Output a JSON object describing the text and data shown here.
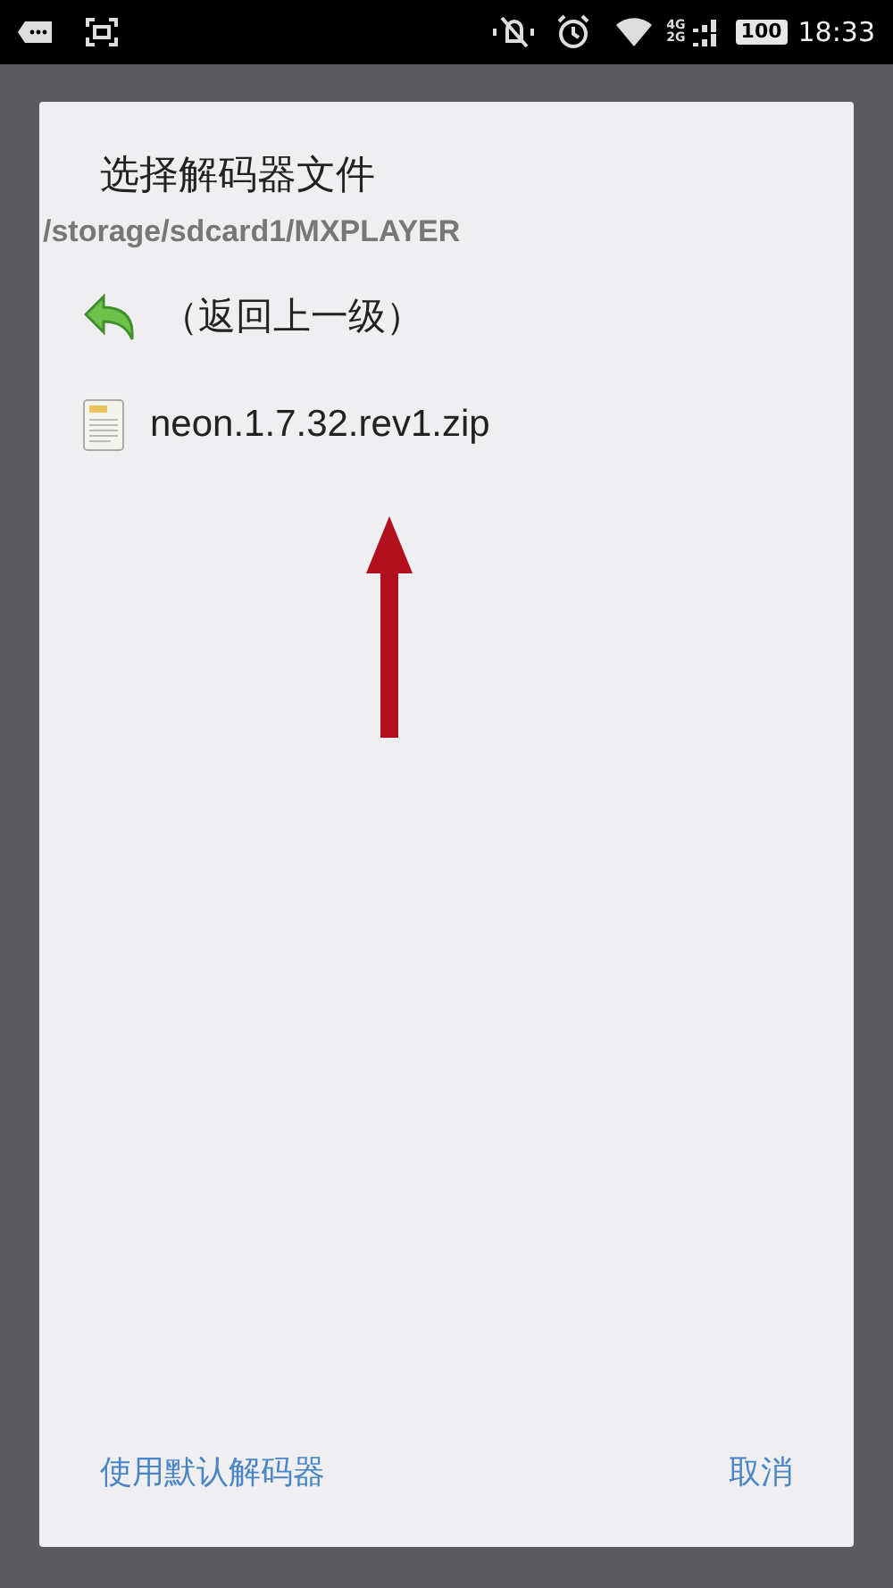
{
  "status_bar": {
    "network_top": "4G",
    "network_bottom": "2G",
    "battery": "100",
    "time": "18:33"
  },
  "dialog": {
    "title": "选择解码器文件",
    "path": "/storage/sdcard1/MXPLAYER",
    "items": [
      {
        "kind": "up",
        "label": "（返回上一级）"
      },
      {
        "kind": "file",
        "label": "neon.1.7.32.rev1.zip"
      }
    ],
    "buttons": [
      "使用默认解码器",
      "取消"
    ]
  }
}
